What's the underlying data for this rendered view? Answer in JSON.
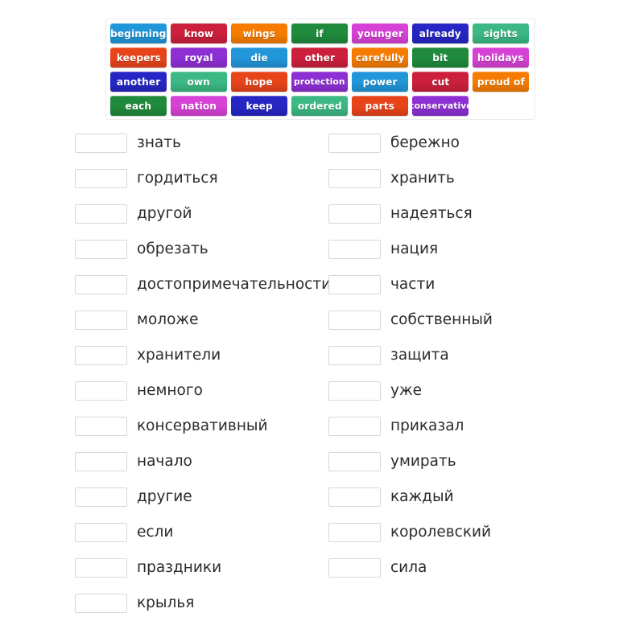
{
  "word_bank": {
    "rows": [
      [
        {
          "label": "beginning",
          "color": "#2196d9"
        },
        {
          "label": "know",
          "color": "#cc1f3c"
        },
        {
          "label": "wings",
          "color": "#f57c00"
        },
        {
          "label": "if",
          "color": "#1f8a3c"
        },
        {
          "label": "younger",
          "color": "#d641d6"
        },
        {
          "label": "already",
          "color": "#2626c4"
        },
        {
          "label": "sights",
          "color": "#3bb883"
        }
      ],
      [
        {
          "label": "keepers",
          "color": "#e8441a"
        },
        {
          "label": "royal",
          "color": "#8e2fd4"
        },
        {
          "label": "die",
          "color": "#2196d9"
        },
        {
          "label": "other",
          "color": "#cc1f3c"
        },
        {
          "label": "carefully",
          "color": "#f57c00"
        },
        {
          "label": "bit",
          "color": "#1f8a3c"
        },
        {
          "label": "holidays",
          "color": "#d641d6"
        }
      ],
      [
        {
          "label": "another",
          "color": "#2626c4"
        },
        {
          "label": "own",
          "color": "#3bb883"
        },
        {
          "label": "hope",
          "color": "#e8441a"
        },
        {
          "label": "protection",
          "color": "#8e2fd4"
        },
        {
          "label": "power",
          "color": "#2196d9"
        },
        {
          "label": "cut",
          "color": "#cc1f3c"
        },
        {
          "label": "proud of",
          "color": "#f57c00"
        }
      ],
      [
        {
          "label": "each",
          "color": "#1f8a3c"
        },
        {
          "label": "nation",
          "color": "#d641d6"
        },
        {
          "label": "keep",
          "color": "#2626c4"
        },
        {
          "label": "ordered",
          "color": "#3bb883"
        },
        {
          "label": "parts",
          "color": "#e8441a"
        },
        {
          "label": "conservative",
          "color": "#8e2fd4"
        },
        {
          "label": "",
          "color": "#ffffff"
        }
      ]
    ]
  },
  "answers": {
    "left": [
      "знать",
      "гордиться",
      "другой",
      "обрезать",
      "достопримечательности",
      "моложе",
      "хранители",
      "немного",
      "консервативный",
      "начало",
      "другие",
      "если",
      "праздники",
      "крылья"
    ],
    "right": [
      "бережно",
      "хранить",
      "надеяться",
      "нация",
      "части",
      "собственный",
      "защита",
      "уже",
      "приказал",
      "умирать",
      "каждый",
      "королевский",
      "сила"
    ]
  }
}
